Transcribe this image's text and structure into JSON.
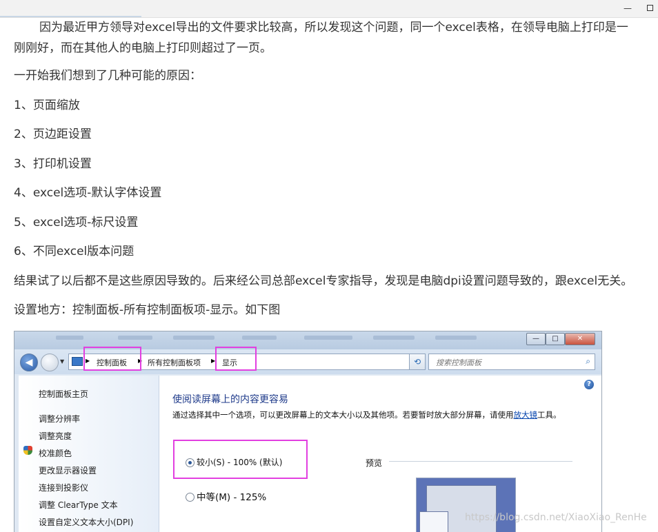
{
  "window": {
    "minimize_glyph": "—",
    "maximize_icon": "maximize-icon"
  },
  "article": {
    "para1_line1": "因为最近甲方领导对excel导出的文件要求比较高，所以发现这个问题，同一个excel表格，在领导电脑上打印是一",
    "para1_line2": "刚刚好，而在其他人的电脑上打印则超过了一页。",
    "intro": "一开始我们想到了几种可能的原因：",
    "reasons": [
      "1、页面缩放",
      "2、页边距设置",
      "3、打印机设置",
      "4、excel选项-默认字体设置",
      "5、excel选项-标尺设置",
      "6、不同excel版本问题"
    ],
    "result": "结果试了以后都不是这些原因导致的。后来经公司总部excel专家指导，发现是电脑dpi设置问题导致的，跟excel无关。",
    "settings_location": "设置地方：控制面板-所有控制面板项-显示。如下图"
  },
  "screenshot": {
    "window_buttons": {
      "minimize": "—",
      "maximize": "□",
      "close": "✕"
    },
    "address": {
      "crumbs": [
        "控制面板",
        "所有控制面板项",
        "显示"
      ],
      "search_placeholder": "搜索控制面板"
    },
    "sidebar": {
      "items": [
        "控制面板主页",
        "调整分辨率",
        "调整亮度",
        "校准颜色",
        "更改显示器设置",
        "连接到投影仪",
        "调整 ClearType 文本",
        "设置自定义文本大小(DPI)"
      ]
    },
    "main": {
      "heading": "使阅读屏幕上的内容更容易",
      "desc_before_link": "通过选择其中一个选项，可以更改屏幕上的文本大小以及其他项。若要暂时放大部分屏幕，请使用",
      "desc_link": "放大镜",
      "desc_after_link": "工具。",
      "options": [
        {
          "label": "较小(S) - 100% (默认)",
          "selected": true
        },
        {
          "label": "中等(M) - 125%",
          "selected": false
        }
      ],
      "preview_label": "预览"
    },
    "highlight_color": "#e23fe0"
  },
  "watermark": "https://blog.csdn.net/XiaoXiao_RenHe"
}
